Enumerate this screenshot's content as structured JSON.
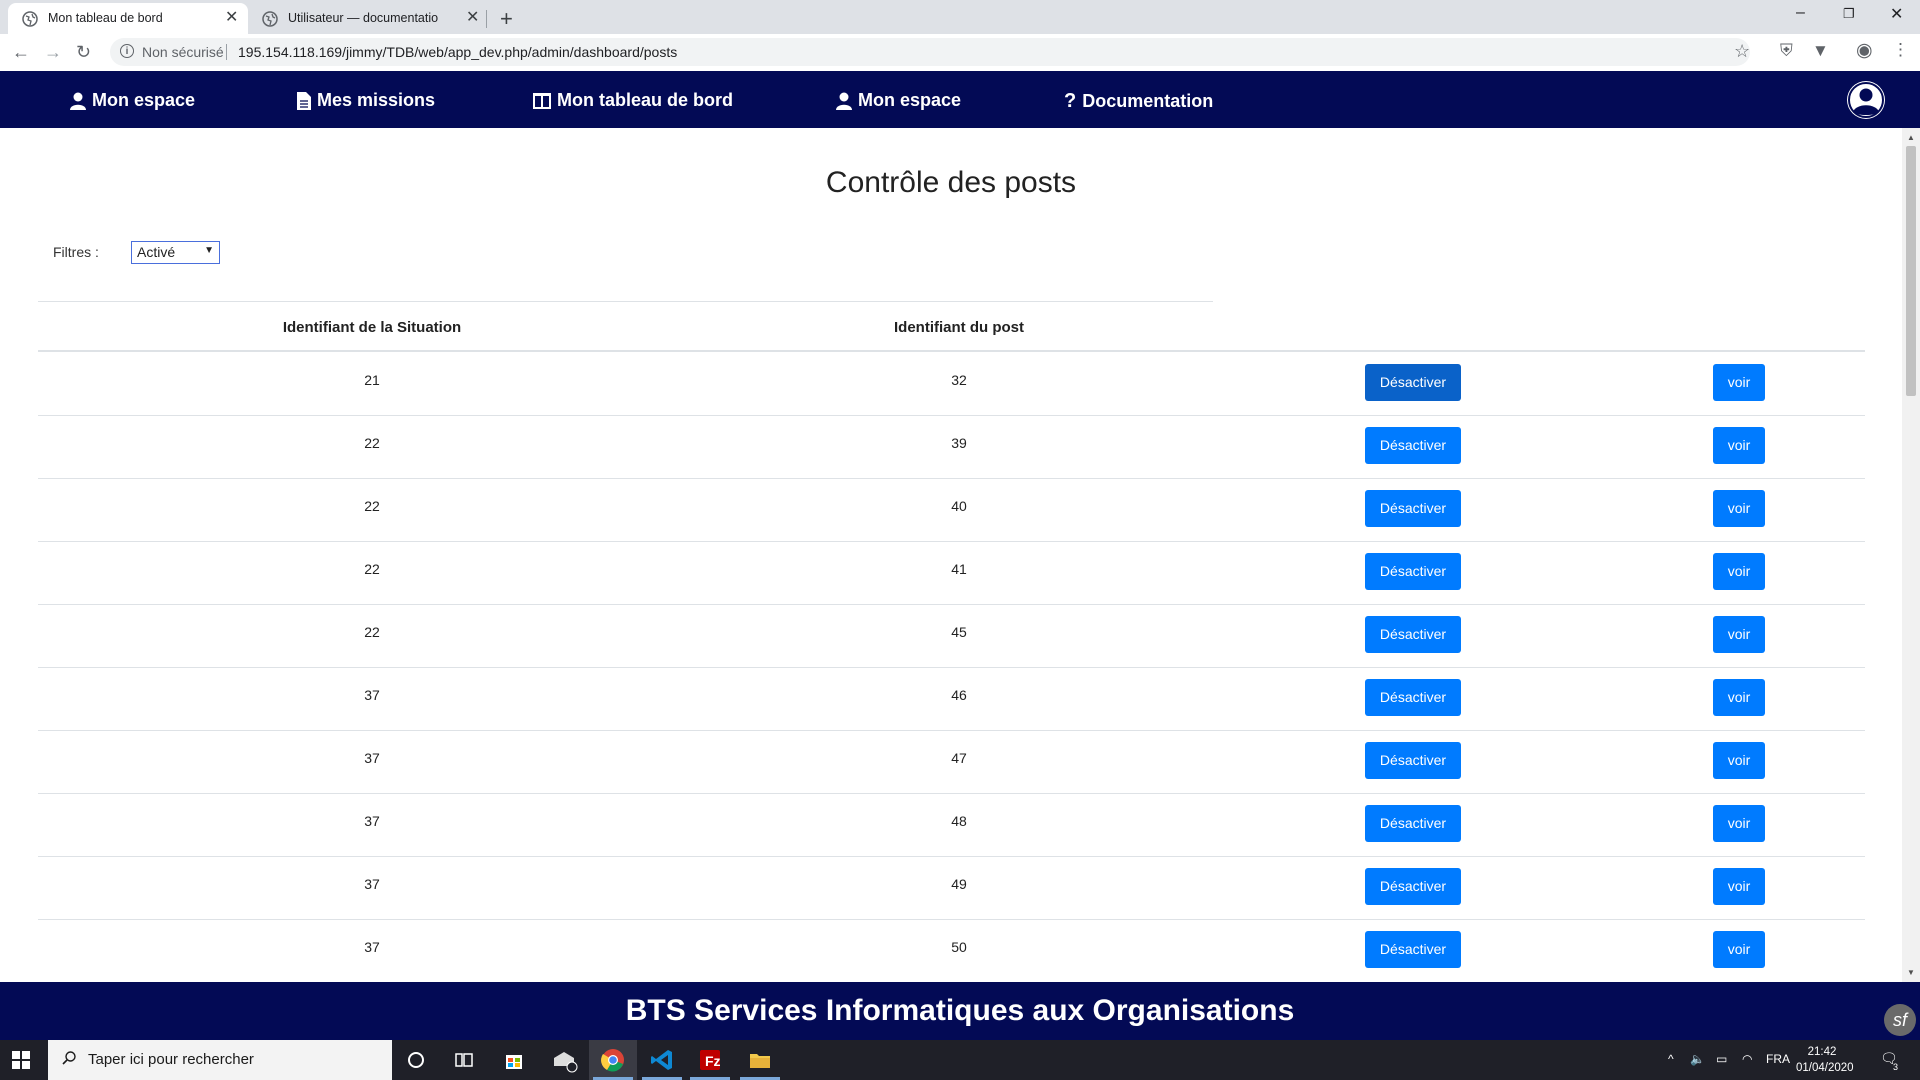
{
  "browser": {
    "tabs": [
      {
        "title": "Mon tableau de bord",
        "active": true
      },
      {
        "title": "Utilisateur — documentation Tab",
        "active": false
      }
    ],
    "security_label": "Non sécurisé",
    "url": "195.154.118.169/jimmy/TDB/web/app_dev.php/admin/dashboard/posts"
  },
  "nav": {
    "items": [
      {
        "label": "Mon espace",
        "icon": "user-icon"
      },
      {
        "label": "Mes missions",
        "icon": "file-icon"
      },
      {
        "label": "Mon tableau de bord",
        "icon": "columns-icon"
      },
      {
        "label": "Mon espace",
        "icon": "user-icon"
      },
      {
        "label": "Documentation",
        "icon": "question-icon"
      }
    ],
    "brand_color": "#030a55"
  },
  "page": {
    "title": "Contrôle des posts",
    "filter_label": "Filtres :",
    "filter_value": "Activé"
  },
  "table": {
    "headers": [
      "Identifiant de la Situation",
      "Identifiant du post"
    ],
    "action_label": "Désactiver",
    "view_label": "voir",
    "rows": [
      {
        "situation": "21",
        "post": "32"
      },
      {
        "situation": "22",
        "post": "39"
      },
      {
        "situation": "22",
        "post": "40"
      },
      {
        "situation": "22",
        "post": "41"
      },
      {
        "situation": "22",
        "post": "45"
      },
      {
        "situation": "37",
        "post": "46"
      },
      {
        "situation": "37",
        "post": "47"
      },
      {
        "situation": "37",
        "post": "48"
      },
      {
        "situation": "37",
        "post": "49"
      },
      {
        "situation": "37",
        "post": "50"
      }
    ],
    "button_color": "#007bff"
  },
  "footer": {
    "text": "BTS Services Informatiques aux Organisations"
  },
  "taskbar": {
    "search_placeholder": "Taper ici pour rechercher",
    "lang": "FRA",
    "time": "21:42",
    "date": "01/04/2020",
    "notification_count": "3"
  }
}
